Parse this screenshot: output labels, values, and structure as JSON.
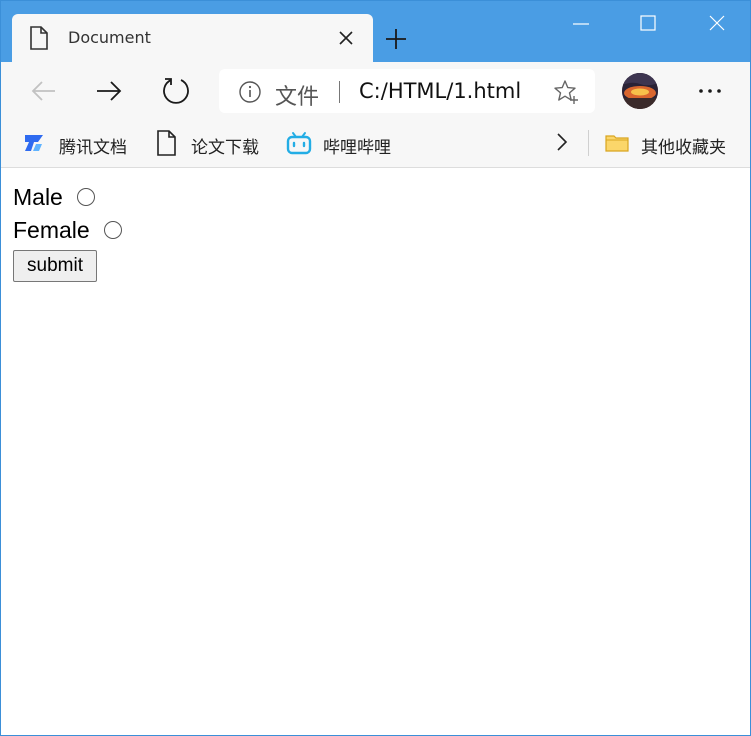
{
  "browser": {
    "tab": {
      "title": "Document",
      "icon": "page-icon",
      "close_icon": "close-icon"
    },
    "new_tab_icon": "plus-icon",
    "window_controls": [
      "minimize-icon",
      "maximize-icon",
      "close-icon"
    ],
    "toolbar": {
      "back_icon": "arrow-left-icon",
      "forward_icon": "arrow-right-icon",
      "refresh_icon": "refresh-icon",
      "address": {
        "info_icon": "info-icon",
        "scheme_label": "文件",
        "url": "C:/HTML/1.html",
        "favorite_icon": "star-add-icon"
      },
      "profile_icon": "avatar",
      "menu_icon": "more-icon"
    },
    "bookmarks": {
      "items": [
        {
          "label": "腾讯文档",
          "icon": "tencent-docs-icon"
        },
        {
          "label": "论文下载",
          "icon": "page-icon"
        },
        {
          "label": "哔哩哔哩",
          "icon": "bilibili-icon"
        }
      ],
      "overflow_icon": "chevron-right-icon",
      "other_folder": {
        "label": "其他收藏夹",
        "icon": "folder-icon"
      }
    }
  },
  "form": {
    "options": [
      {
        "label": "Male",
        "checked": false
      },
      {
        "label": "Female",
        "checked": false
      }
    ],
    "submit_label": "submit"
  },
  "colors": {
    "titlebar": "#4a9de4",
    "toolbar": "#f7f7f7",
    "bilibili": "#23ade5",
    "tencent_docs": "#2f6bf0",
    "folder": "#f5c242"
  }
}
